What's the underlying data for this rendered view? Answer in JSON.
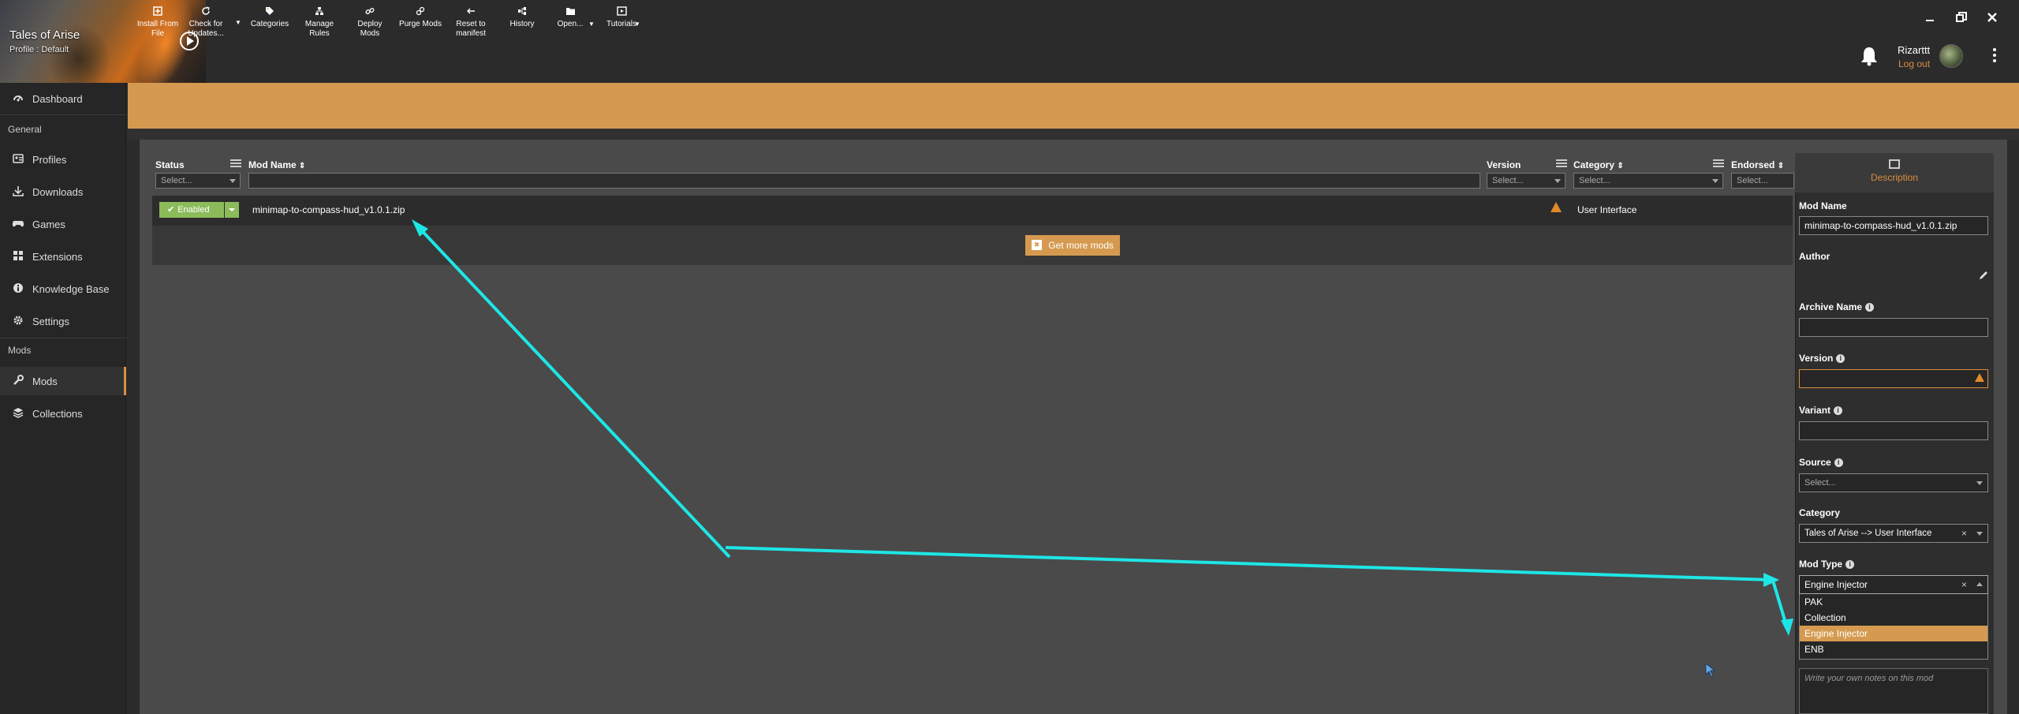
{
  "header": {
    "game_title": "Tales of Arise",
    "profile": "Profile : Default",
    "user_name": "Rizarttt",
    "logout": "Log out",
    "window_controls": [
      "minimize-icon",
      "restore-icon",
      "close-icon"
    ]
  },
  "sidebar": {
    "items": [
      {
        "label": "Dashboard",
        "icon": "dashboard-icon"
      },
      {
        "label": "Profiles",
        "icon": "profiles-icon"
      },
      {
        "label": "Downloads",
        "icon": "download-icon"
      },
      {
        "label": "Games",
        "icon": "gamepad-icon"
      },
      {
        "label": "Extensions",
        "icon": "extensions-icon"
      },
      {
        "label": "Knowledge Base",
        "icon": "info-icon"
      },
      {
        "label": "Settings",
        "icon": "gear-icon"
      },
      {
        "label": "Mods",
        "icon": "wrench-icon"
      },
      {
        "label": "Collections",
        "icon": "collections-icon"
      }
    ],
    "sections": {
      "general": "General",
      "mods": "Mods"
    },
    "active": "Mods",
    "accent": "#d98f3f"
  },
  "toolbar": {
    "accent": "#d59a4f",
    "buttons": [
      {
        "label": "Install From File",
        "line1": "Install From",
        "line2": "File"
      },
      {
        "label": "Check for Updates...",
        "line1": "Check for",
        "line2": "Updates..."
      },
      {
        "label": "Categories"
      },
      {
        "label": "Manage Rules",
        "line1": "Manage",
        "line2": "Rules"
      },
      {
        "label": "Deploy Mods"
      },
      {
        "label": "Purge Mods"
      },
      {
        "label": "Reset to manifest",
        "line1": "Reset to",
        "line2": "manifest"
      },
      {
        "label": "History"
      },
      {
        "label": "Open..."
      },
      {
        "label": "Tutorials"
      }
    ]
  },
  "table": {
    "columns": {
      "status": "Status",
      "mod_name": "Mod Name",
      "version": "Version",
      "category": "Category",
      "endorsed": "Endorsed"
    },
    "filter_placeholder": "Select...",
    "rows": [
      {
        "status": "Enabled",
        "name": "minimap-to-compass-hud_v1.0.1.zip",
        "category": "User Interface",
        "warning": true
      }
    ],
    "get_more": "Get more mods"
  },
  "panel": {
    "tab": "Description",
    "mod_name_label": "Mod Name",
    "mod_name_value": "minimap-to-compass-hud_v1.0.1.zip",
    "author_label": "Author",
    "archive_label": "Archive Name",
    "version_label": "Version",
    "variant_label": "Variant",
    "source_label": "Source",
    "source_placeholder": "Select...",
    "category_label": "Category",
    "category_value": "Tales of Arise --> User Interface",
    "mod_type_label": "Mod Type",
    "mod_type_value": "Engine Injector",
    "mod_type_options": [
      "PAK",
      "Collection",
      "Engine Injector",
      "ENB"
    ],
    "selected_option": "Engine Injector",
    "notes_placeholder": "Write your own notes on this mod",
    "clear_glyph": "×"
  },
  "colors": {
    "enabled": "#8cbc5a",
    "warning": "#e08a2a",
    "annotation": "#1ee6e6"
  }
}
